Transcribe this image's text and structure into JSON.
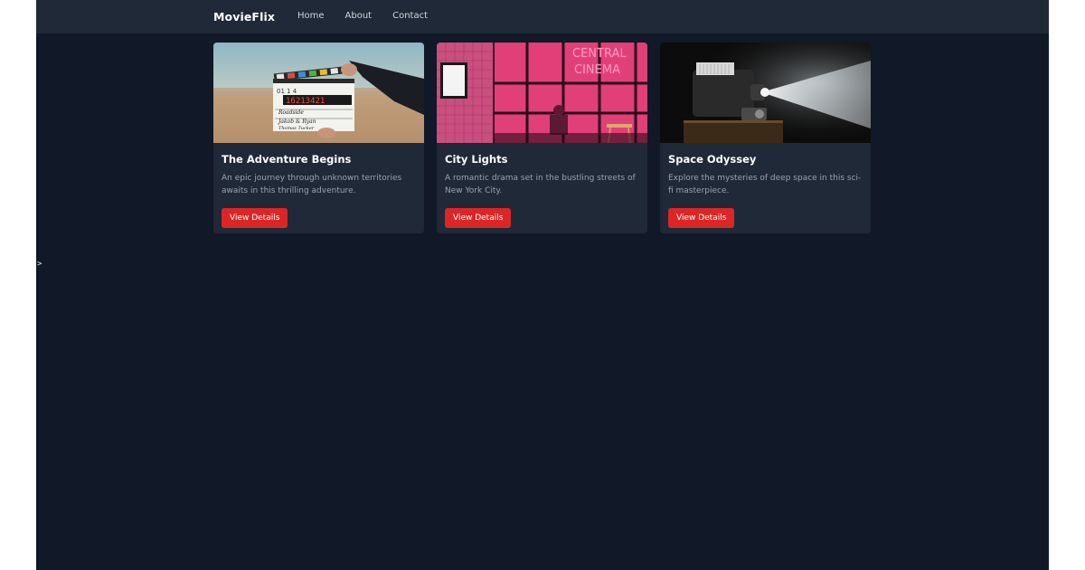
{
  "app": {
    "brand": "MovieFlix"
  },
  "nav": {
    "links": [
      {
        "label": "Home"
      },
      {
        "label": "About"
      },
      {
        "label": "Contact"
      }
    ]
  },
  "movies": [
    {
      "title": "The Adventure Begins",
      "description": "An epic journey through unknown territories awaits in this thrilling adventure.",
      "button": "View Details",
      "image_scene": "clapperboard-desert",
      "clapper_text": [
        "Roadside",
        "Jakob & Ryan",
        "Thomas Tucker"
      ],
      "clapper_digits": "16213421"
    },
    {
      "title": "City Lights",
      "description": "A romantic drama set in the bustling streets of New York City.",
      "button": "View Details",
      "image_scene": "neon-cinema",
      "neon_sign": [
        "CENTRAL",
        "CINEMA"
      ]
    },
    {
      "title": "Space Odyssey",
      "description": "Explore the mysteries of deep space in this sci-fi masterpiece.",
      "button": "View Details",
      "image_scene": "film-projector"
    }
  ],
  "stray_text": ">",
  "colors": {
    "page_bg": "#111827",
    "nav_bg": "#1f2937",
    "card_bg": "#1f2937",
    "accent": "#dc2626",
    "text_muted": "#9ca3af"
  }
}
